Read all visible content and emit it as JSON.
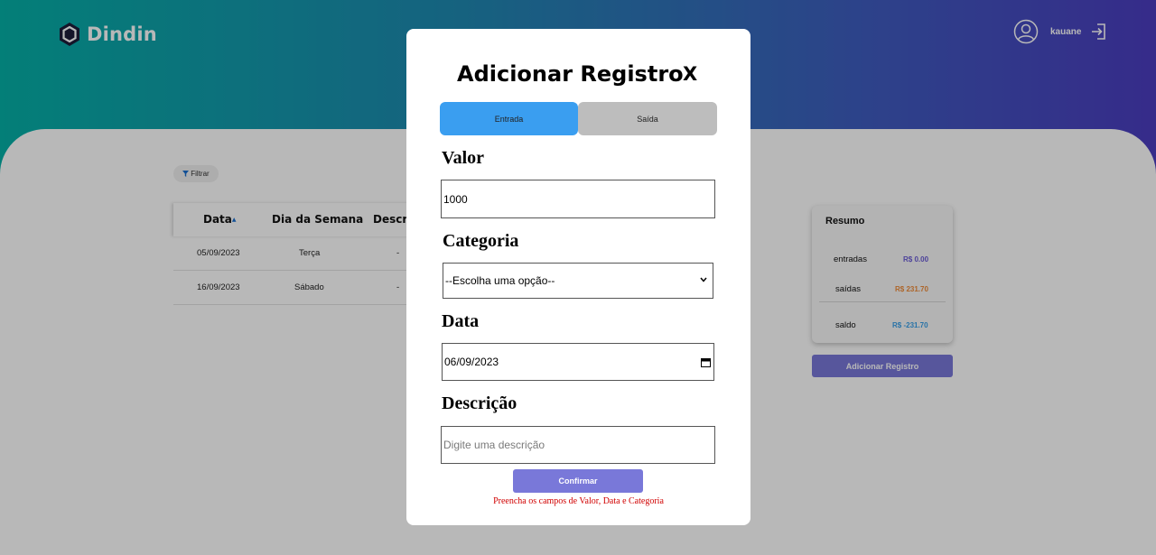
{
  "app": {
    "name": "Dindin"
  },
  "header": {
    "username": "kauane"
  },
  "filter": {
    "label": "Filtrar"
  },
  "table": {
    "columns": [
      "Data",
      "Dia da Semana",
      "Descri"
    ],
    "rows": [
      {
        "date": "05/09/2023",
        "weekday": "Terça",
        "description": "-"
      },
      {
        "date": "16/09/2023",
        "weekday": "Sábado",
        "description": "-"
      }
    ]
  },
  "resumo": {
    "title": "Resumo",
    "entradas_label": "entradas",
    "entradas_value": "R$ 0.00",
    "saidas_label": "saídas",
    "saidas_value": "R$ 231.70",
    "saldo_label": "saldo",
    "saldo_value": "R$ -231.70",
    "add_button": "Adicionar Registro"
  },
  "modal": {
    "title": "Adicionar Registro",
    "close": "X",
    "tabs": {
      "entrada": "Entrada",
      "saida": "Saída"
    },
    "valor_label": "Valor",
    "valor_value": "1000",
    "categoria_label": "Categoria",
    "categoria_selected": "--Escolha uma opção--",
    "data_label": "Data",
    "data_value": "06/09/2023",
    "descricao_label": "Descrição",
    "descricao_placeholder": "Digite uma descrição",
    "confirm": "Confirmar",
    "error": "Preencha os campos de Valor, Data e Categoria"
  },
  "colors": {
    "accent": "#7978d9",
    "tab_active": "#3a9ef0",
    "entradas": "#6a5bd6",
    "saidas": "#f08c3a",
    "saldo": "#3aa0e8",
    "error": "#d10000"
  }
}
